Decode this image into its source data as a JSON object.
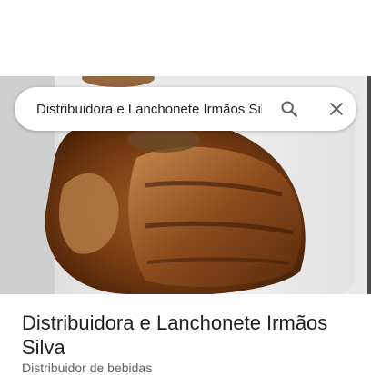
{
  "search": {
    "value": "Distribuidora e Lanchonete Irmãos Silva",
    "search_icon": "search-icon",
    "close_icon": "close-icon"
  },
  "place": {
    "name": "Distribuidora e Lanchonete Irmãos Silva",
    "category": "Distribuidor de bebidas"
  },
  "colors": {
    "text_primary": "#202124",
    "text_secondary": "#5f6368",
    "icon": "#5f6368"
  }
}
